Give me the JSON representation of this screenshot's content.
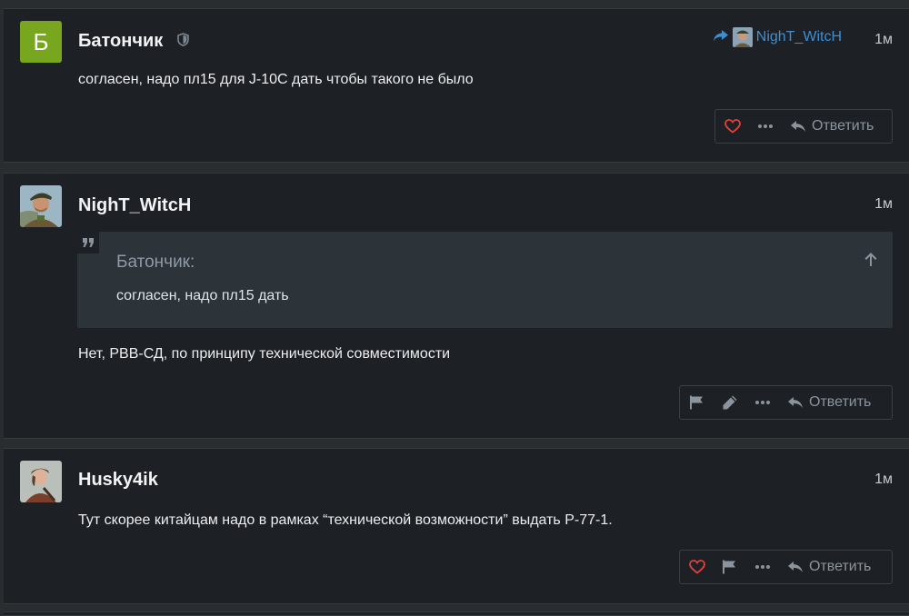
{
  "posts": [
    {
      "author": "Батончик",
      "avatar_letter": "Б",
      "avatar_color": "#78a71f",
      "time": "1м",
      "reply_to": "NighT_WitcH",
      "text": "согласен, надо пл15 для J-10C дать чтобы такого не было",
      "reply_label": "Ответить",
      "icons": [
        "shield-icon",
        "heart-icon",
        "more-icon",
        "reply-icon"
      ]
    },
    {
      "author": "NighT_WitcH",
      "time": "1м",
      "quote": {
        "author": "Батончик:",
        "text": "согласен, надо пл15 дать"
      },
      "text": "Нет, РВВ-СД, по принципу технической совместимости",
      "reply_label": "Ответить",
      "icons": [
        "flag-icon",
        "edit-icon",
        "more-icon",
        "reply-icon"
      ]
    },
    {
      "author": "Husky4ik",
      "time": "1м",
      "text": "Тут скорее китайцам надо в рамках “технической возможности” выдать Р-77-1.",
      "reply_label": "Ответить",
      "icons": [
        "heart-icon",
        "flag-icon",
        "more-icon",
        "reply-icon"
      ]
    }
  ],
  "colors": {
    "accent": "#3d8fd1",
    "heart": "#e0403a",
    "post_bg": "#1d2125"
  }
}
